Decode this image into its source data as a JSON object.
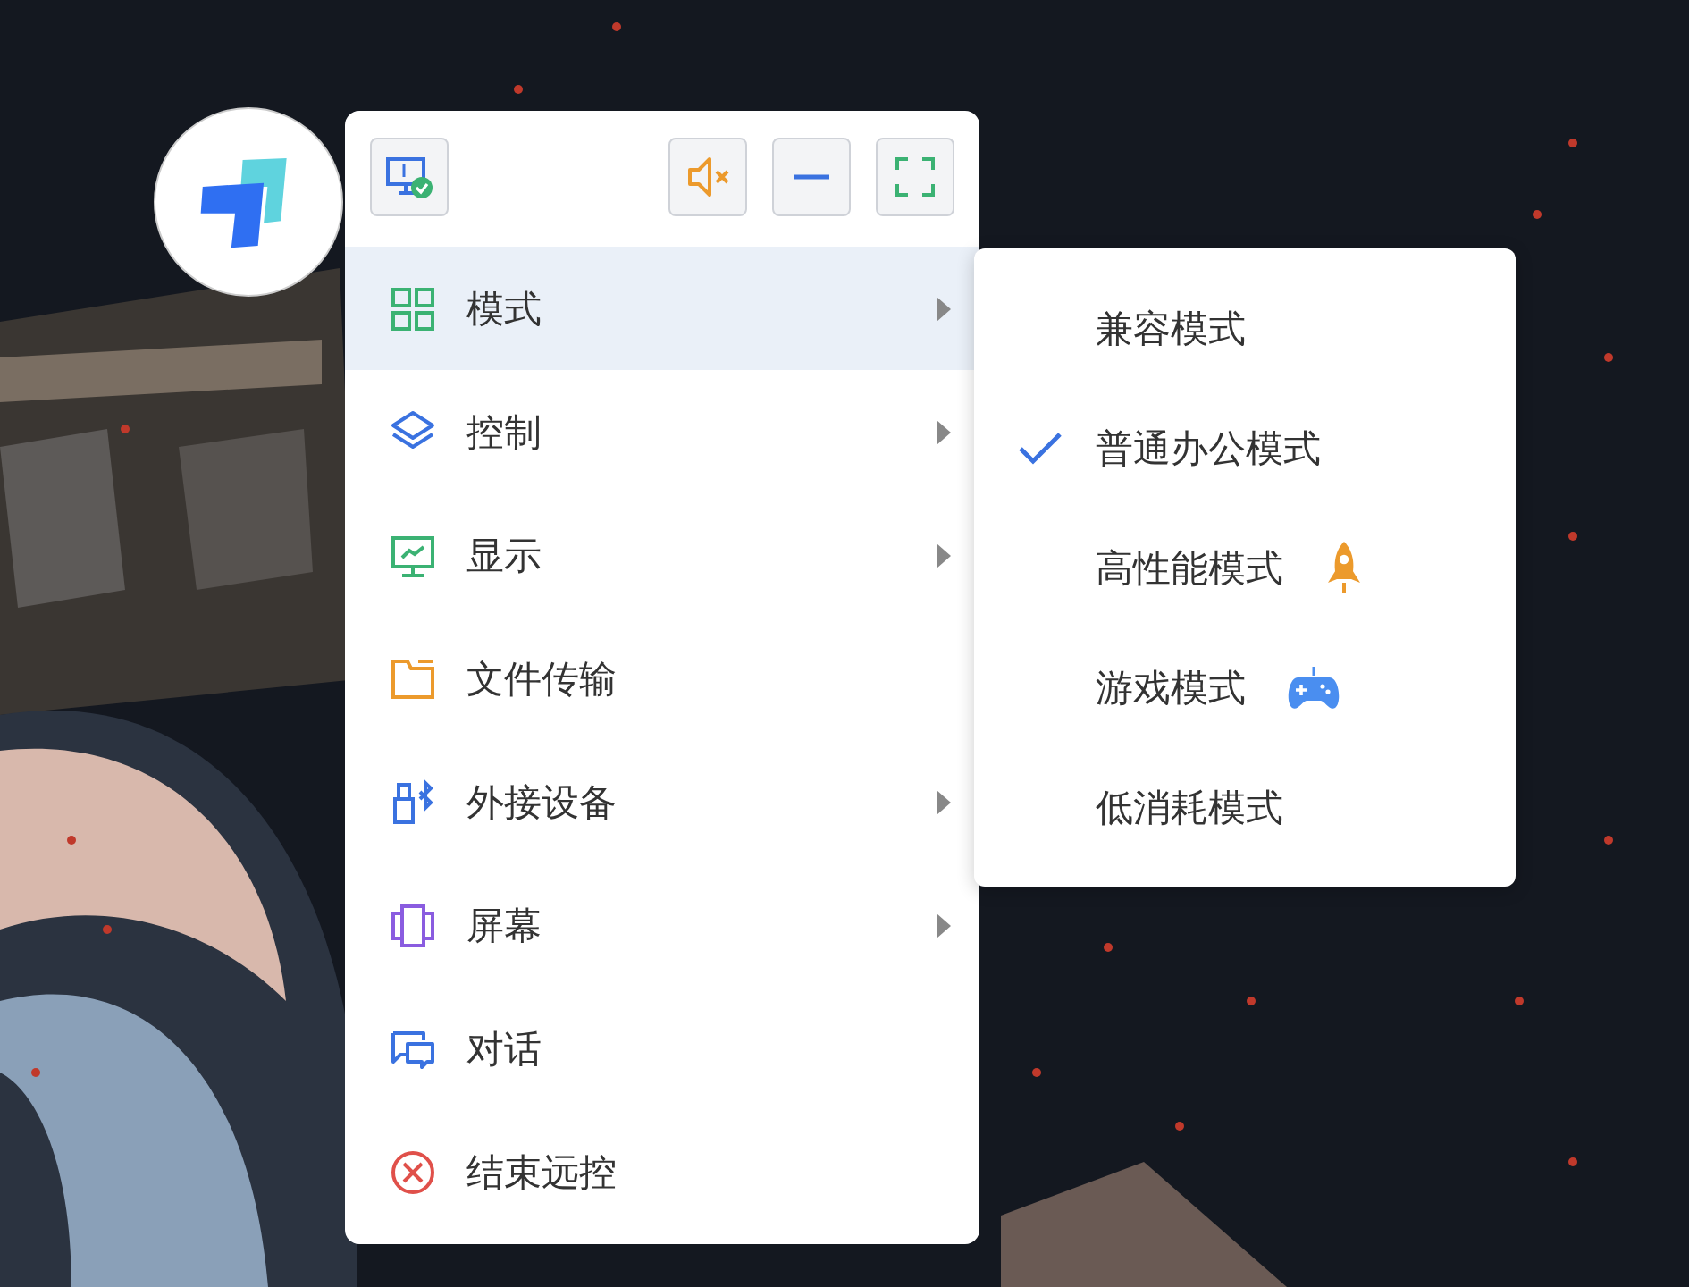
{
  "menu": {
    "items": [
      {
        "label": "模式",
        "submenu": true,
        "selected": true
      },
      {
        "label": "控制",
        "submenu": true,
        "selected": false
      },
      {
        "label": "显示",
        "submenu": true,
        "selected": false
      },
      {
        "label": "文件传输",
        "submenu": false,
        "selected": false
      },
      {
        "label": "外接设备",
        "submenu": true,
        "selected": false
      },
      {
        "label": "屏幕",
        "submenu": true,
        "selected": false
      },
      {
        "label": "对话",
        "submenu": false,
        "selected": false
      },
      {
        "label": "结束远控",
        "submenu": false,
        "selected": false
      }
    ]
  },
  "submenu": {
    "items": [
      {
        "label": "兼容模式",
        "selected": false
      },
      {
        "label": "普通办公模式",
        "selected": true
      },
      {
        "label": "高性能模式",
        "selected": false
      },
      {
        "label": "游戏模式",
        "selected": false
      },
      {
        "label": "低消耗模式",
        "selected": false
      }
    ]
  }
}
